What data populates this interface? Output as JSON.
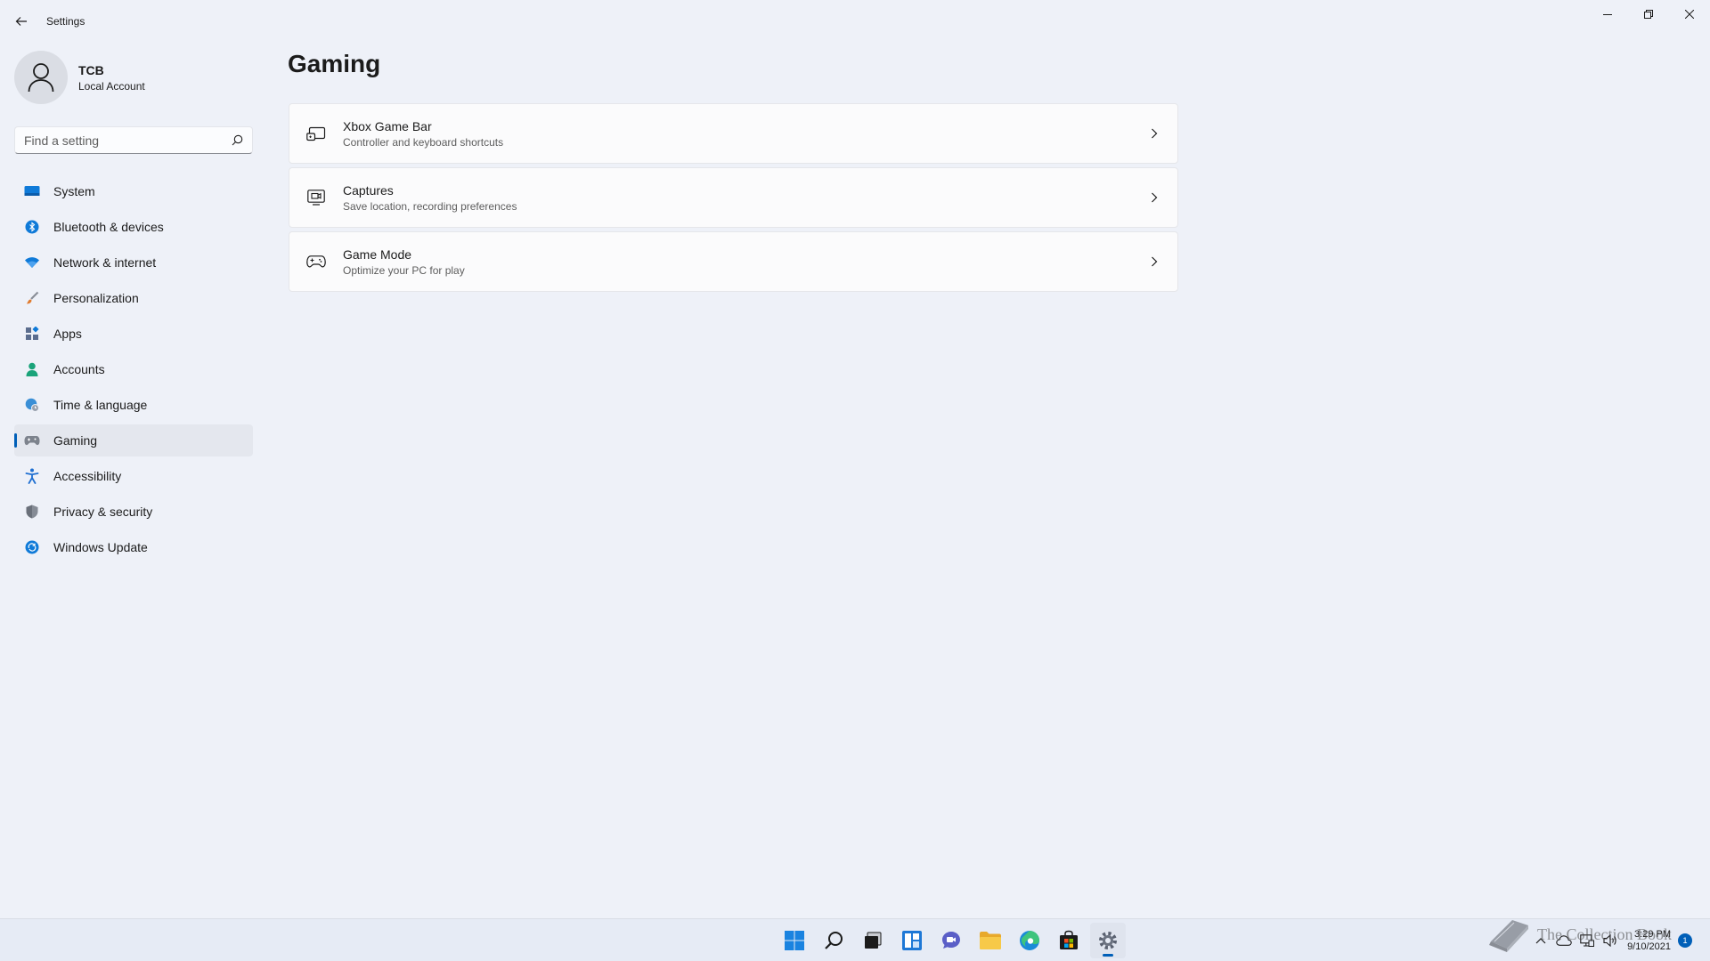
{
  "window": {
    "title": "Settings",
    "controls": [
      "minimize",
      "restore",
      "close"
    ]
  },
  "profile": {
    "name": "TCB",
    "account_type": "Local Account"
  },
  "search": {
    "placeholder": "Find a setting"
  },
  "sidebar": {
    "items": [
      {
        "label": "System",
        "icon": "system-icon",
        "color": "#0078d4"
      },
      {
        "label": "Bluetooth & devices",
        "icon": "bluetooth-icon",
        "color": "#0078d4"
      },
      {
        "label": "Network & internet",
        "icon": "wifi-icon",
        "color": "#0078d4"
      },
      {
        "label": "Personalization",
        "icon": "paintbrush-icon",
        "color": "#d67a2a"
      },
      {
        "label": "Apps",
        "icon": "apps-icon",
        "color": "#5a6b8a"
      },
      {
        "label": "Accounts",
        "icon": "person-icon",
        "color": "#1aa37a"
      },
      {
        "label": "Time & language",
        "icon": "globe-clock-icon",
        "color": "#2a7fc1"
      },
      {
        "label": "Gaming",
        "icon": "controller-icon",
        "color": "#6f7580",
        "active": true
      },
      {
        "label": "Accessibility",
        "icon": "accessibility-icon",
        "color": "#1f6fd1"
      },
      {
        "label": "Privacy & security",
        "icon": "shield-icon",
        "color": "#6f7580"
      },
      {
        "label": "Windows Update",
        "icon": "update-icon",
        "color": "#0f7ad8"
      }
    ]
  },
  "main": {
    "title": "Gaming",
    "cards": [
      {
        "title": "Xbox Game Bar",
        "subtitle": "Controller and keyboard shortcuts",
        "icon": "game-bar-icon"
      },
      {
        "title": "Captures",
        "subtitle": "Save location, recording preferences",
        "icon": "capture-icon"
      },
      {
        "title": "Game Mode",
        "subtitle": "Optimize your PC for play",
        "icon": "gamepad-icon"
      }
    ]
  },
  "taskbar": {
    "apps": [
      "start-icon",
      "search-icon",
      "task-view-icon",
      "widgets-icon",
      "chat-icon",
      "file-explorer-icon",
      "edge-icon",
      "store-icon",
      "settings-icon"
    ],
    "active_app": "settings-icon",
    "clock_time": "3:29 PM",
    "clock_date": "9/10/2021",
    "notification_count": "1"
  },
  "watermark": {
    "text": "The Collection Book"
  },
  "colors": {
    "accent": "#005fb8",
    "background": "#eef1f8",
    "card": "#fbfbfc"
  }
}
